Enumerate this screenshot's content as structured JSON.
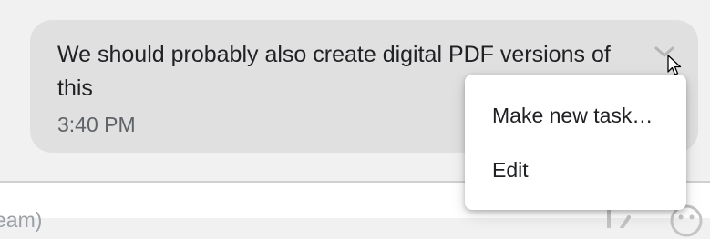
{
  "message": {
    "text": "We should probably also create digital PDF versions of this",
    "time": "3:40 PM"
  },
  "message_actions": {
    "chevron_icon": "chevron-down-icon"
  },
  "context_menu": {
    "items": [
      {
        "label": "Make new task…"
      },
      {
        "label": "Edit"
      }
    ]
  },
  "composer": {
    "placeholder_fragment": "eam)"
  },
  "icons": {
    "attach": "attach-icon",
    "emoji": "emoji-icon",
    "cursor": "mouse-pointer-icon"
  },
  "colors": {
    "bubble": "#e0e0e0",
    "background": "#f1f1f1",
    "text": "#202124",
    "secondary_text": "#5f6368",
    "menu_bg": "#ffffff"
  }
}
